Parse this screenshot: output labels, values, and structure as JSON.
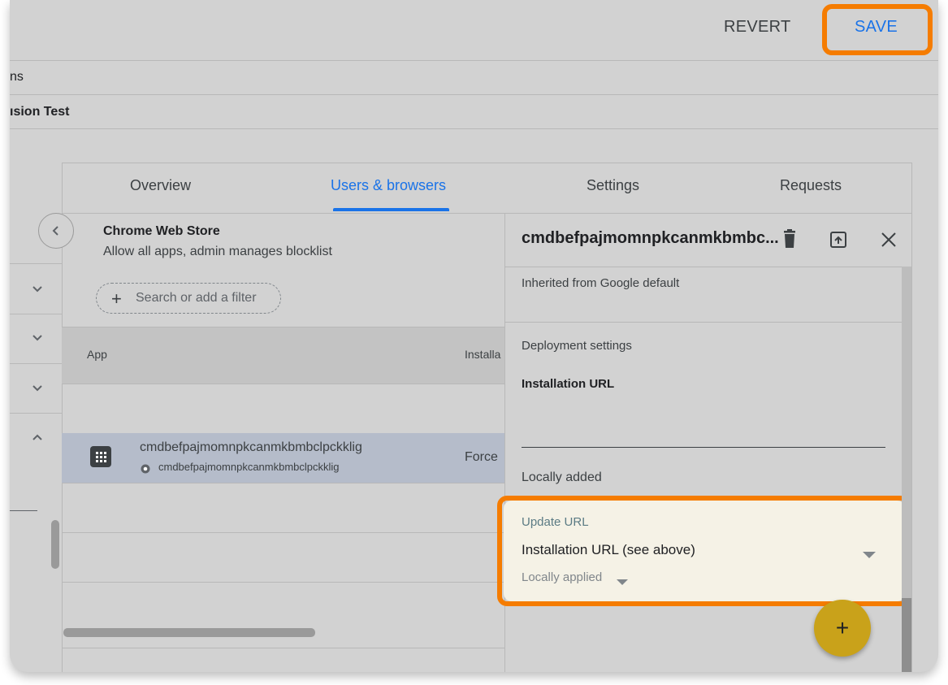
{
  "toolbar": {
    "revert_label": "REVERT",
    "save_label": "SAVE"
  },
  "breadcrumb": {
    "line1": "ns",
    "line2": "ısion Test"
  },
  "tabs": [
    "Overview",
    "Users & browsers",
    "Settings",
    "Requests"
  ],
  "active_tab_color": "#1a73e8",
  "left_panel": {
    "title": "Chrome Web Store",
    "subtitle": "Allow all apps, admin manages blocklist",
    "filter_placeholder": "Search or add a filter",
    "col_app": "App",
    "col_install": "Installa",
    "row": {
      "name": "cmdbefpajmomnpkcanmkbmbclpckklig",
      "id": "cmdbefpajmomnpkcanmkbmbclpckklig",
      "policy": "Force"
    }
  },
  "detail": {
    "title": "cmdbefpajmomnpkcanmkbmbc...",
    "inherited": "Inherited from Google default",
    "deployment": "Deployment settings",
    "install_url_label": "Installation URL",
    "locally_added": "Locally added",
    "update_url_label": "Update URL",
    "update_url_value": "Installation URL (see above)",
    "locally_applied": "Locally applied"
  },
  "fab": {
    "label": "+",
    "color": "#c9a21a"
  },
  "highlight_color": "#f57c00"
}
